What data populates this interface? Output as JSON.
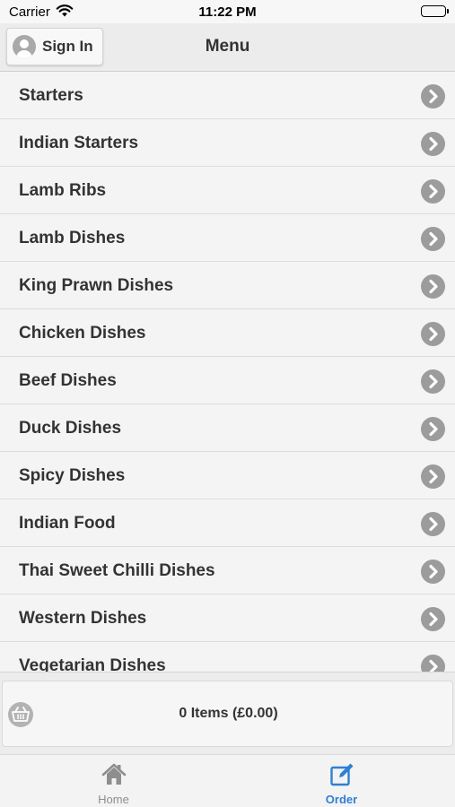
{
  "status_bar": {
    "carrier": "Carrier",
    "time": "11:22 PM"
  },
  "header": {
    "sign_in_label": "Sign In",
    "title": "Menu"
  },
  "menu": {
    "items": [
      {
        "label": "Starters"
      },
      {
        "label": "Indian Starters"
      },
      {
        "label": "Lamb Ribs"
      },
      {
        "label": "Lamb Dishes"
      },
      {
        "label": "King Prawn Dishes"
      },
      {
        "label": "Chicken Dishes"
      },
      {
        "label": "Beef Dishes"
      },
      {
        "label": "Duck Dishes"
      },
      {
        "label": "Spicy Dishes"
      },
      {
        "label": "Indian Food"
      },
      {
        "label": "Thai Sweet Chilli Dishes"
      },
      {
        "label": "Western Dishes"
      },
      {
        "label": "Vegetarian Dishes"
      }
    ]
  },
  "cart": {
    "summary": "0 Items (£0.00)"
  },
  "tab_bar": {
    "home_label": "Home",
    "order_label": "Order",
    "active_tab": "Order"
  },
  "colors": {
    "accent": "#2f7fd4",
    "chevron": "#9c9c9c",
    "inactive_tab": "#8e8e8e",
    "text": "#333333"
  },
  "icons": {
    "status_wifi": "wifi-icon",
    "status_battery": "battery-icon",
    "sign_in": "user-avatar-icon",
    "row_chevron": "chevron-right-icon",
    "cart": "basket-icon",
    "home_tab": "home-icon",
    "order_tab": "edit-order-icon"
  }
}
